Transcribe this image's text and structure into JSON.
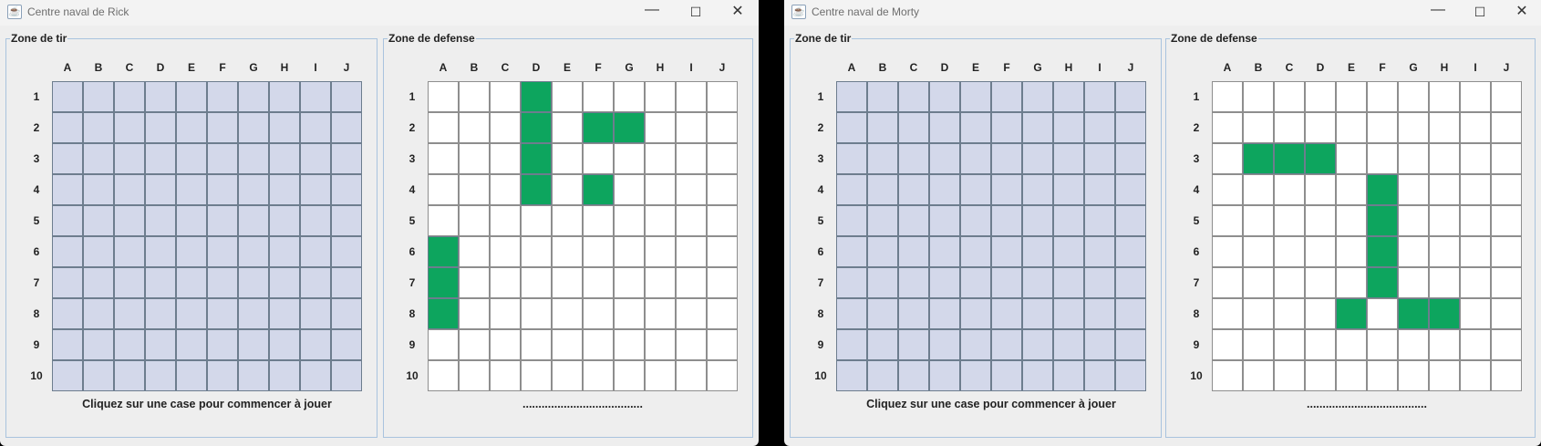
{
  "columns": [
    "A",
    "B",
    "C",
    "D",
    "E",
    "F",
    "G",
    "H",
    "I",
    "J"
  ],
  "rows": [
    "1",
    "2",
    "3",
    "4",
    "5",
    "6",
    "7",
    "8",
    "9",
    "10"
  ],
  "colors": {
    "hidden_cell": "#d3d8ea",
    "empty_cell": "#ffffff",
    "ship_cell": "#0da55e",
    "panel_border": "#a9c3de"
  },
  "icons": {
    "app": "java-icon",
    "minimize": "minimize-icon",
    "maximize": "maximize-icon",
    "close": "close-icon"
  },
  "windows": [
    {
      "title": "Centre naval de Rick",
      "shot_zone": {
        "legend": "Zone de tir",
        "status": "Cliquez sur une case pour commencer à jouer"
      },
      "defense_zone": {
        "legend": "Zone de defense",
        "status": "......................................",
        "ships": [
          "D1",
          "D2",
          "D3",
          "D4",
          "F2",
          "G2",
          "F4",
          "A6",
          "A7",
          "A8"
        ]
      }
    },
    {
      "title": "Centre naval de Morty",
      "shot_zone": {
        "legend": "Zone de tir",
        "status": "Cliquez sur une case pour commencer à jouer"
      },
      "defense_zone": {
        "legend": "Zone de defense",
        "status": "......................................",
        "ships": [
          "B3",
          "C3",
          "D3",
          "F4",
          "F5",
          "F6",
          "F7",
          "E8",
          "G8",
          "H8"
        ]
      }
    }
  ]
}
